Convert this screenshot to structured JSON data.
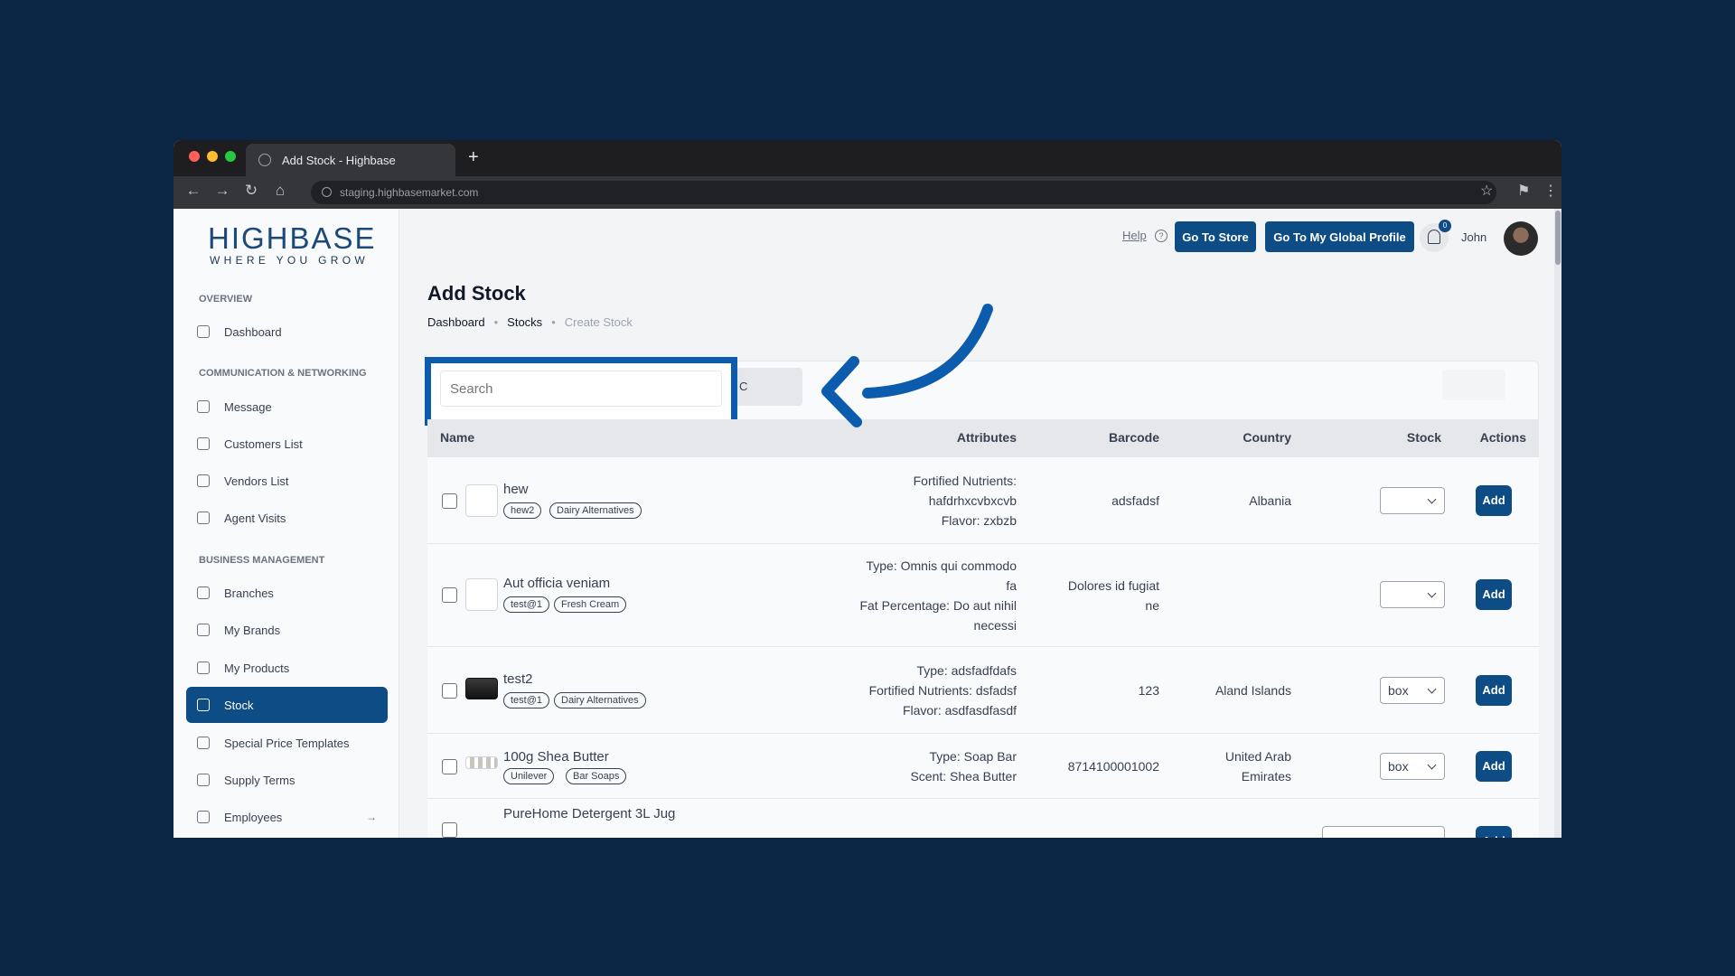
{
  "browser": {
    "tab_title": "Add Stock - Highbase",
    "url": "staging.highbasemarket.com",
    "new_tab": "+",
    "back": "←",
    "forward": "→",
    "reload": "↻",
    "home": "⌂",
    "star": "☆",
    "ext": "⚑",
    "menu": "⋮"
  },
  "brand": {
    "name": "HIGHBASE",
    "tagline": "WHERE YOU GROW"
  },
  "sidebar": {
    "sections": [
      "OVERVIEW",
      "COMMUNICATION & NETWORKING",
      "BUSINESS MANAGEMENT"
    ],
    "items": [
      {
        "label": "Dashboard",
        "icon": "home-icon"
      },
      {
        "label": "Message",
        "icon": "message-icon"
      },
      {
        "label": "Customers List",
        "icon": "users-icon"
      },
      {
        "label": "Vendors List",
        "icon": "users-icon"
      },
      {
        "label": "Agent Visits",
        "icon": "truck-icon"
      },
      {
        "label": "Branches",
        "icon": "store-icon"
      },
      {
        "label": "My Brands",
        "icon": "star-icon"
      },
      {
        "label": "My Products",
        "icon": "box-icon"
      },
      {
        "label": "Stock",
        "icon": "archive-icon",
        "active": true
      },
      {
        "label": "Special Price Templates",
        "icon": "list-icon"
      },
      {
        "label": "Supply Terms",
        "icon": "info-icon"
      },
      {
        "label": "Employees",
        "icon": "users-icon",
        "arrow": "→"
      }
    ]
  },
  "header": {
    "help": "Help",
    "help_icon": "?",
    "go_store": "Go To Store",
    "global_profile": "Go To My Global Profile",
    "notifications": "0",
    "user": "John"
  },
  "page": {
    "title": "Add Stock",
    "breadcrumb": [
      "Dashboard",
      "Stocks",
      "Create Stock"
    ],
    "breadcrumb_sep": "•",
    "search_placeholder": "Search",
    "filter_label": "C"
  },
  "table": {
    "columns": [
      "Name",
      "Attributes",
      "Barcode",
      "Country",
      "Stock",
      "Actions"
    ],
    "add_label": "Add",
    "rows": [
      {
        "name": "hew",
        "tags": [
          "hew2",
          "Dairy Alternatives"
        ],
        "attributes": [
          "Fortified Nutrients:",
          "hafdrhxcvbxcvb",
          "Flavor: zxbzb"
        ],
        "barcode": [
          "adsfadsf"
        ],
        "country": [
          "Albania"
        ],
        "stock": ""
      },
      {
        "name": "Aut officia veniam",
        "tags": [
          "test@1",
          "Fresh Cream"
        ],
        "attributes": [
          "Type: Omnis qui commodo",
          "fa",
          "Fat Percentage: Do aut nihil",
          "necessi"
        ],
        "barcode": [
          "Dolores id fugiat",
          "ne"
        ],
        "country": [
          ""
        ],
        "stock": ""
      },
      {
        "name": "test2",
        "tags": [
          "test@1",
          "Dairy Alternatives"
        ],
        "attributes": [
          "Type: adsfadfdafs",
          "Fortified Nutrients: dsfadsf",
          "Flavor: asdfasdfasdf"
        ],
        "barcode": [
          "123"
        ],
        "country": [
          "Aland Islands"
        ],
        "stock": "box"
      },
      {
        "name": "100g Shea Butter",
        "tags": [
          "Unilever",
          "Bar Soaps"
        ],
        "attributes": [
          "Type: Soap Bar",
          "Scent: Shea Butter"
        ],
        "barcode": [
          "8714100001002"
        ],
        "country": [
          "United Arab",
          "Emirates"
        ],
        "stock": "box"
      },
      {
        "name": "PureHome Detergent 3L Jug",
        "tags": [],
        "attributes": [],
        "barcode": [],
        "country": [],
        "stock": ""
      }
    ]
  },
  "colors": {
    "background": "#0b2545",
    "primary": "#0d4c85",
    "highlight": "#0b5cad"
  }
}
